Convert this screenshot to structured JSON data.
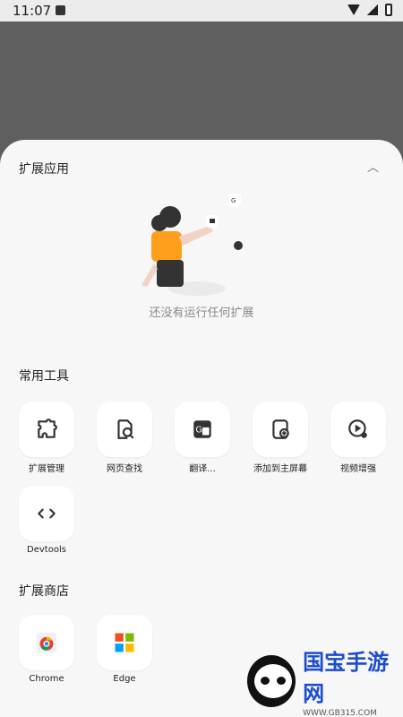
{
  "status": {
    "time": "11:07"
  },
  "sections": {
    "extensions": {
      "title": "扩展应用",
      "empty_text": "还没有运行任何扩展"
    },
    "tools": {
      "title": "常用工具",
      "items": [
        {
          "label": "扩展管理",
          "icon": "puzzle-icon"
        },
        {
          "label": "网页查找",
          "icon": "page-search-icon"
        },
        {
          "label": "翻译...",
          "icon": "translate-icon"
        },
        {
          "label": "添加到主屏幕",
          "icon": "add-home-icon"
        },
        {
          "label": "视频增强",
          "icon": "video-enhance-icon"
        },
        {
          "label": "Devtools",
          "icon": "code-icon"
        }
      ]
    },
    "store": {
      "title": "扩展商店",
      "items": [
        {
          "label": "Chrome",
          "icon": "chrome-icon"
        },
        {
          "label": "Edge",
          "icon": "edge-icon"
        }
      ]
    }
  },
  "watermark": {
    "title": "国宝手游网",
    "subtitle": "WWW.GB315.COM"
  }
}
